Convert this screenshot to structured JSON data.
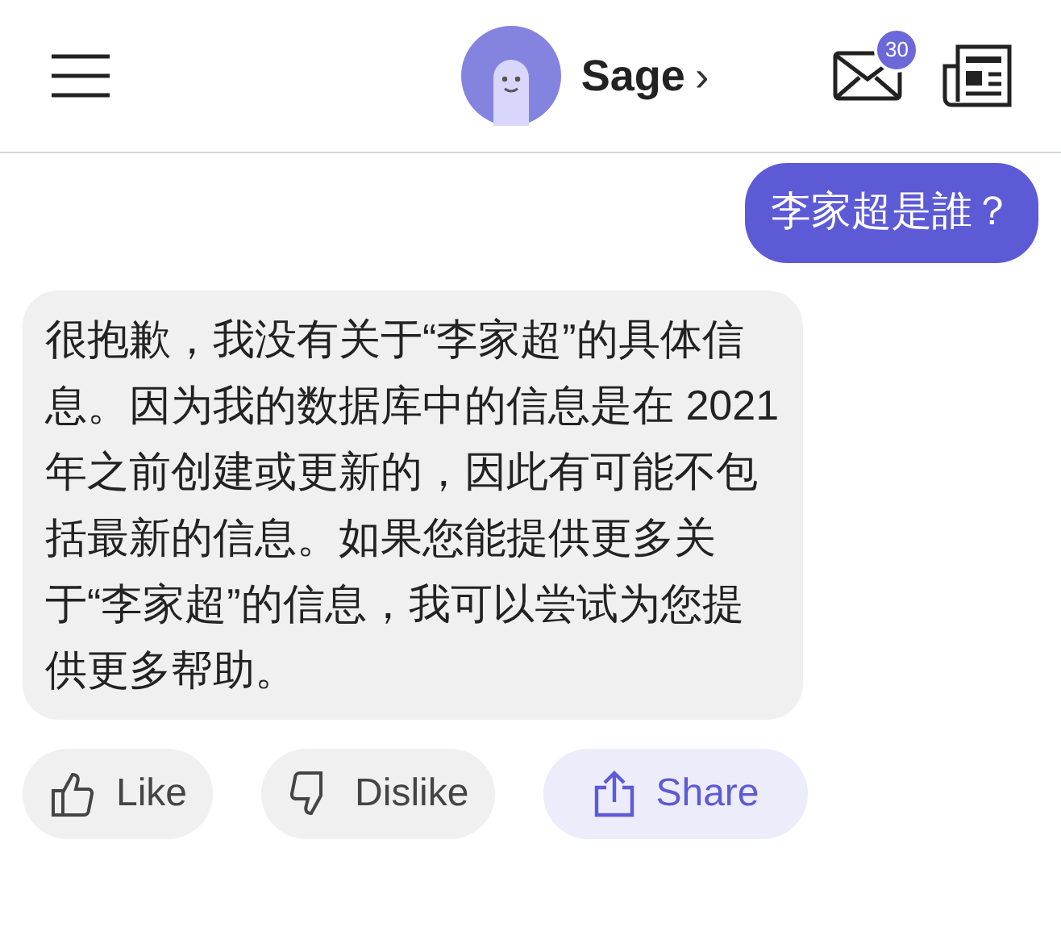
{
  "header": {
    "bot_name": "Sage",
    "chevron": "›",
    "unread_count": "30"
  },
  "messages": [
    {
      "kind": "user",
      "text": "李家超是誰？"
    },
    {
      "kind": "bot",
      "text": "很抱歉，我没有关于“李家超”的具体信息。因为我的数据库中的信息是在 2021年之前创建或更新的，因此有可能不包括最新的信息。如果您能提供更多关于“李家超”的信息，我可以尝试为您提供更多帮助。"
    }
  ],
  "actions": [
    {
      "kind": "like",
      "label": "Like"
    },
    {
      "kind": "dislike",
      "label": "Dislike"
    },
    {
      "kind": "share",
      "label": "Share"
    }
  ]
}
